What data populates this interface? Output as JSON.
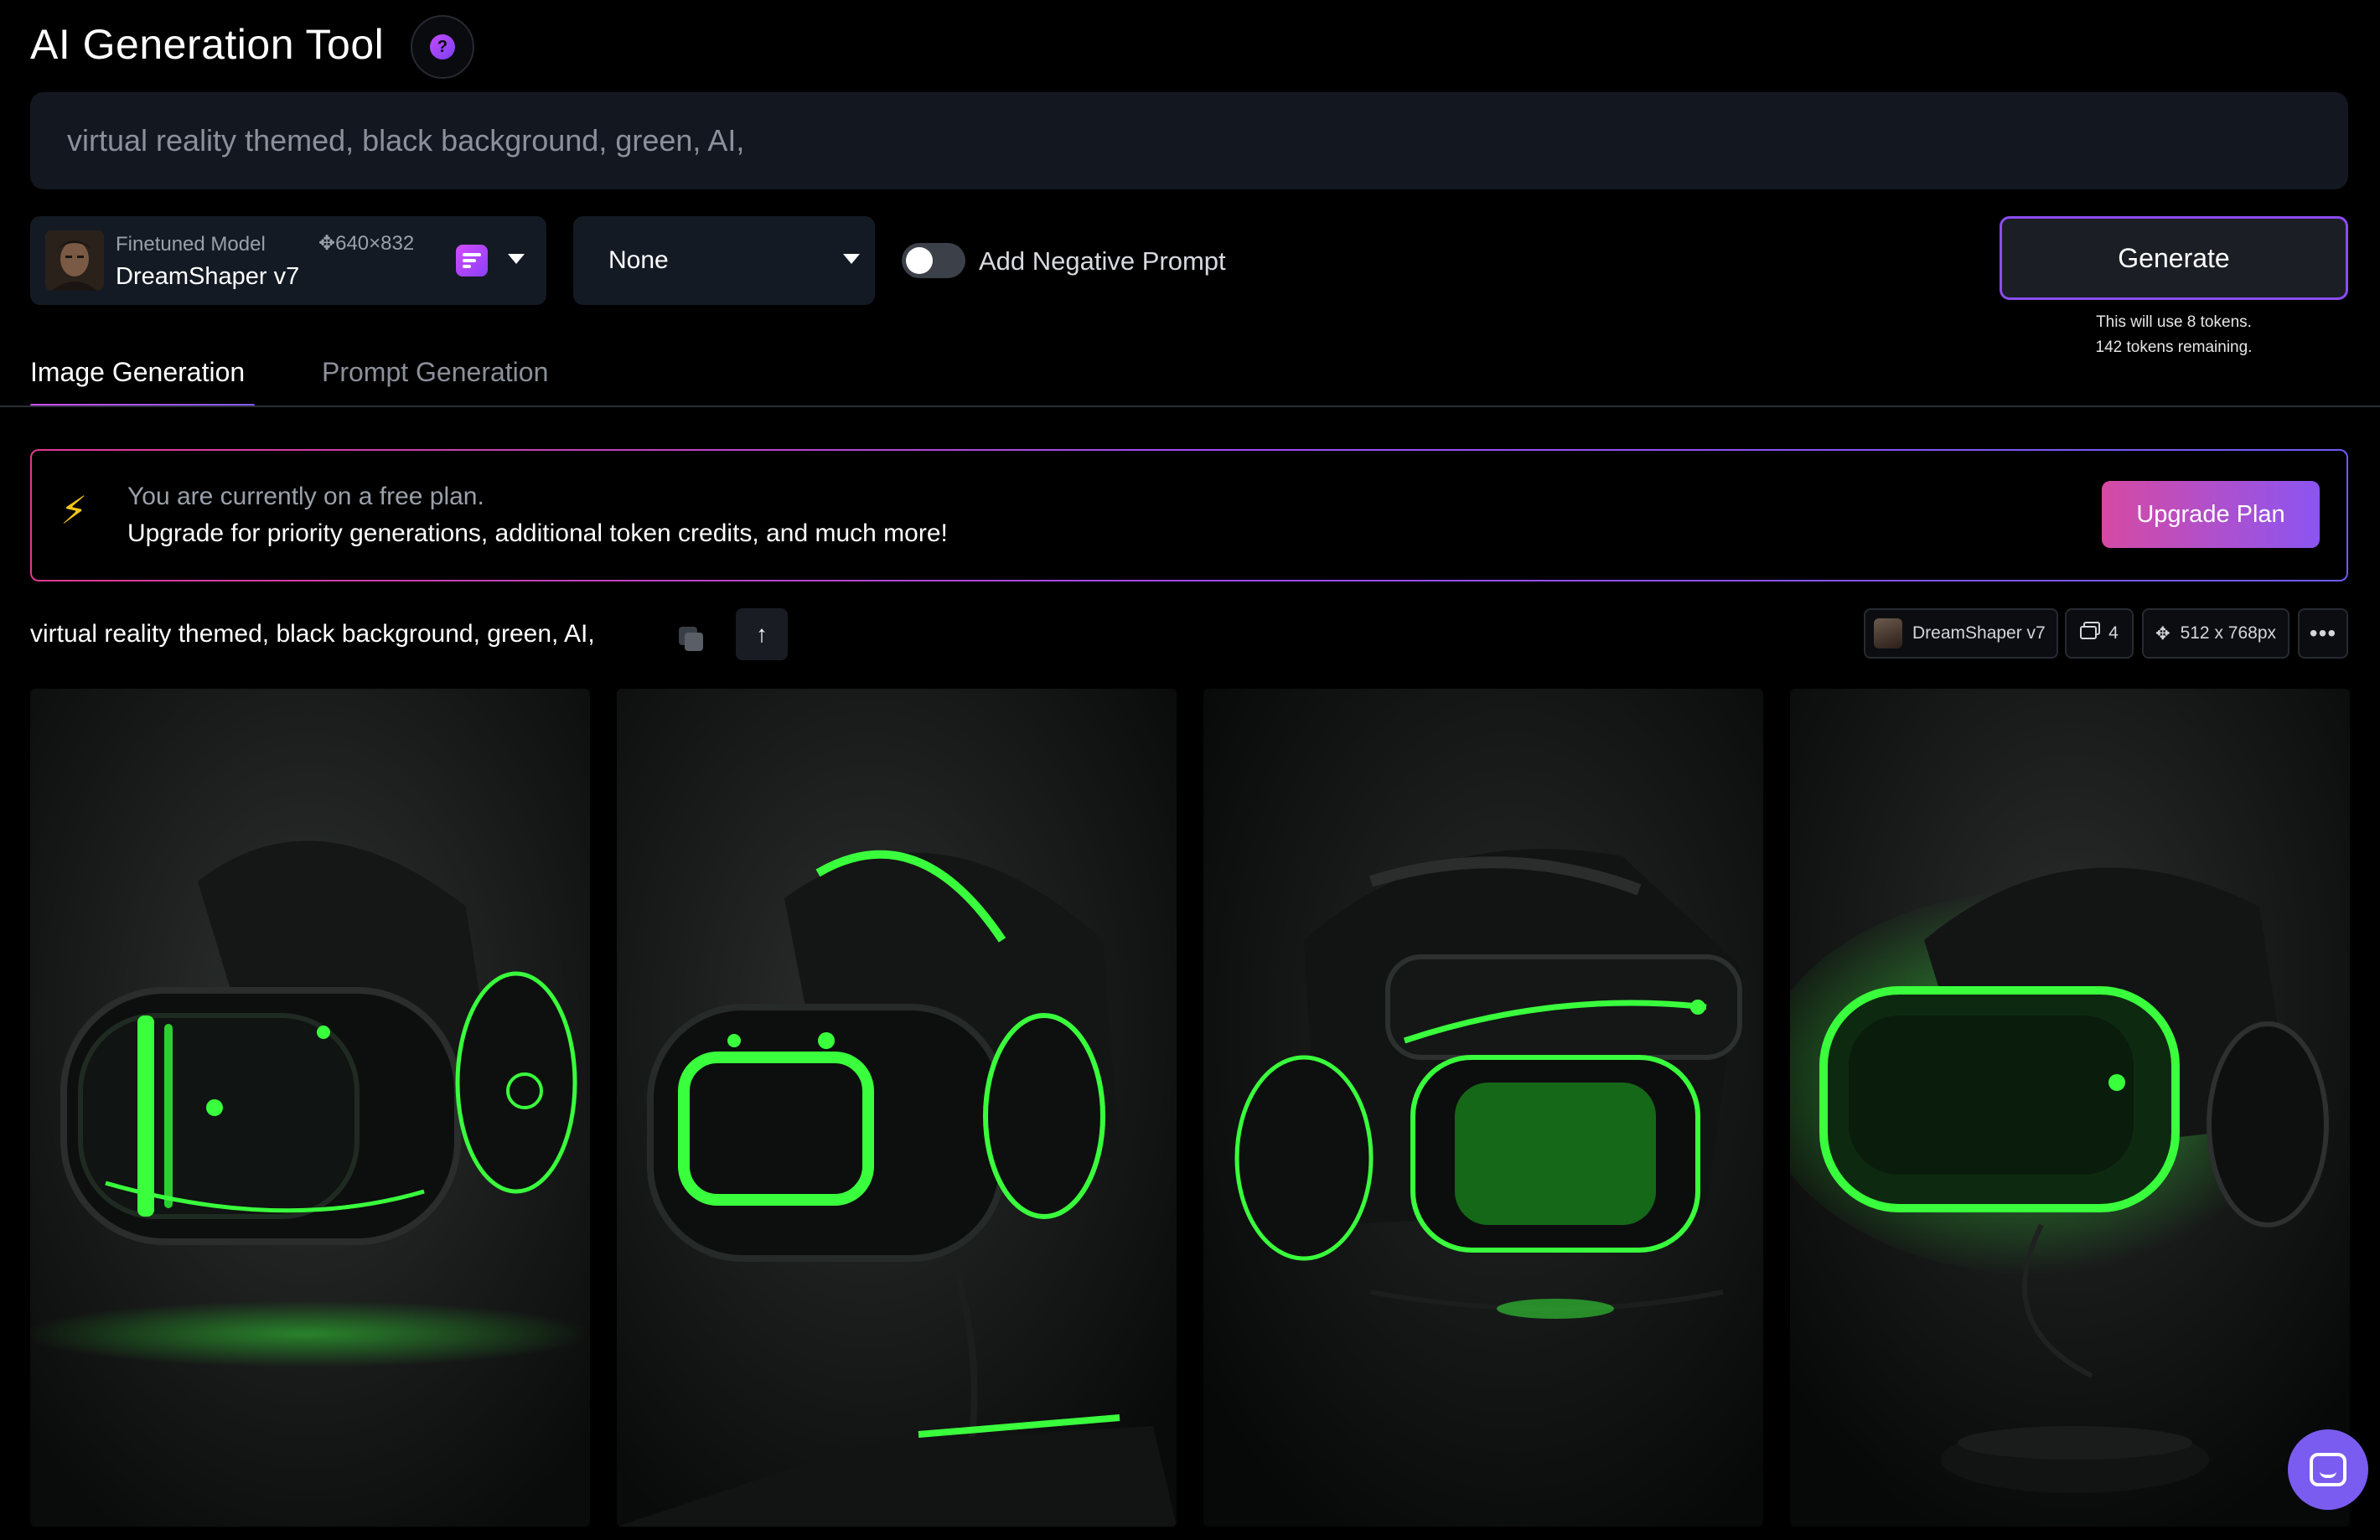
{
  "header": {
    "title": "AI Generation Tool",
    "help_icon": "question-mark-icon"
  },
  "prompt": {
    "value": "virtual reality themed, black background, green, AI,"
  },
  "model_selector": {
    "label": "Finetuned Model",
    "dimensions": "✥640×832",
    "name": "DreamShaper v7",
    "icon": "model-settings-icon"
  },
  "style_dropdown": {
    "selected": "None"
  },
  "negative_prompt": {
    "label": "Add Negative Prompt",
    "enabled": false
  },
  "generate": {
    "label": "Generate",
    "token_use": "This will use 8 tokens.",
    "token_remaining": "142 tokens remaining."
  },
  "tabs": [
    {
      "label": "Image Generation",
      "active": true
    },
    {
      "label": "Prompt Generation",
      "active": false
    }
  ],
  "banner": {
    "line1": "You are currently on a free plan.",
    "line2": "Upgrade for priority generations, additional token credits, and much more!",
    "button": "Upgrade Plan"
  },
  "generation": {
    "prompt": "virtual reality themed, black background, green, AI,",
    "model": "DreamShaper v7",
    "count": "4",
    "size": "512 x 768px",
    "images": [
      "vr-headset-1",
      "vr-headset-2",
      "vr-headset-3",
      "vr-headset-4"
    ]
  },
  "colors": {
    "background": "#000000",
    "surface": "#141a24",
    "accent_purple": "#8a4df0",
    "accent_pink": "#d64aa3",
    "neon_green": "#39ff3c"
  }
}
